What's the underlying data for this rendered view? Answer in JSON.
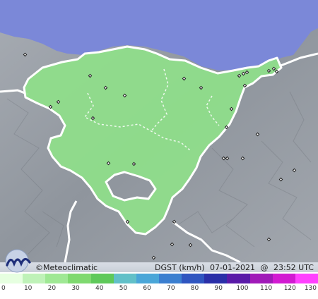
{
  "map": {
    "credit": "©Meteoclimatic",
    "variable_label": "DGST (km/h)",
    "date": "07-01-2021",
    "at": "@",
    "time": "23:52 UTC",
    "colors": {
      "sea": "#7b88d8",
      "land": "#9aa0a8",
      "region": "#8fe08a",
      "border": "#ffffff"
    }
  },
  "legend": {
    "ticks": [
      "0",
      "10",
      "20",
      "30",
      "40",
      "50",
      "60",
      "70",
      "80",
      "90",
      "100",
      "110",
      "120",
      "130"
    ],
    "colors": [
      "#e6ffe0",
      "#bff2b8",
      "#9fe894",
      "#7fd96f",
      "#5fc95a",
      "#62c0c8",
      "#4aa6d8",
      "#3b7fd0",
      "#2f55c0",
      "#2a2fa8",
      "#5a1aa8",
      "#a01ab8",
      "#d21ad2",
      "#ff40ff"
    ]
  }
}
